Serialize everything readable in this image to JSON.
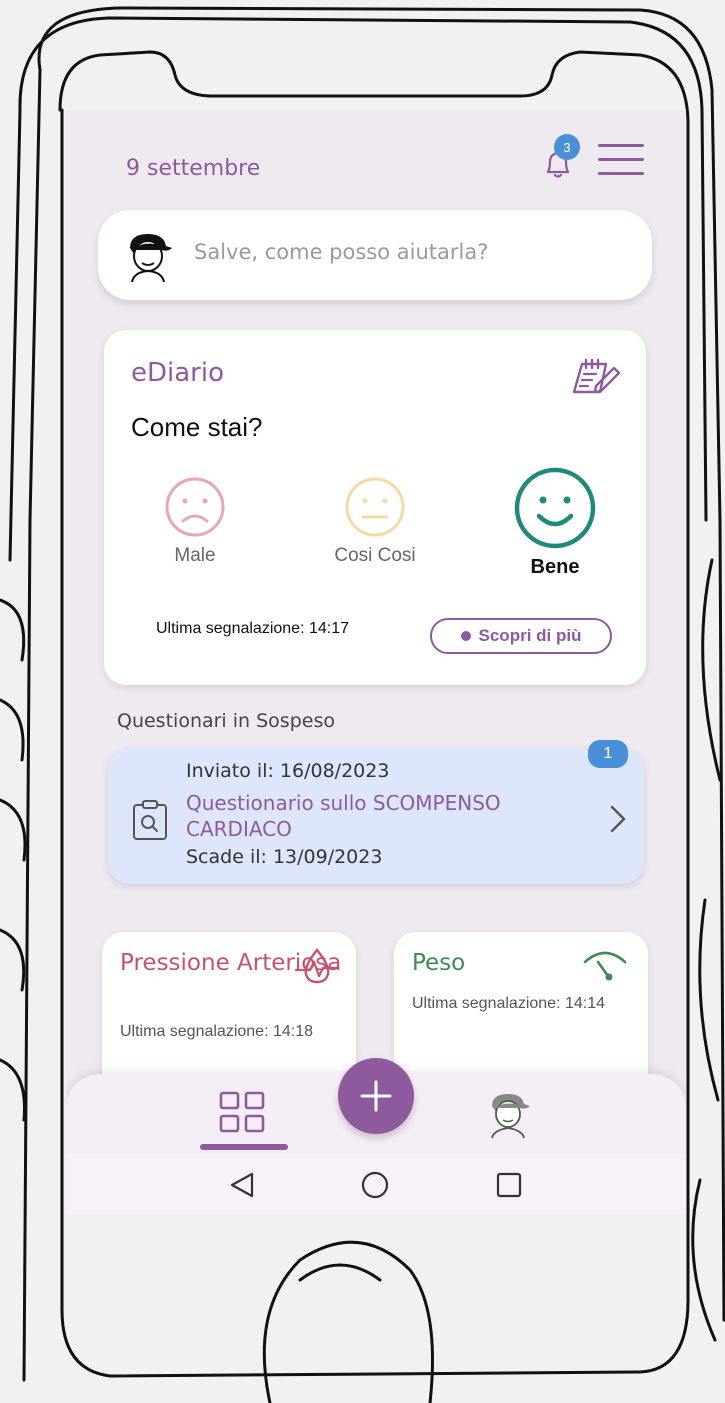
{
  "header": {
    "date": "9 settembre",
    "notification_count": "3"
  },
  "assistant": {
    "placeholder": "Salve, come posso aiutarla?"
  },
  "ediario": {
    "title": "eDiario",
    "question": "Come stai?",
    "moods": [
      {
        "label": "Male",
        "color": "#e8a6b8"
      },
      {
        "label": "Cosi Cosi",
        "color": "#f5d9a6"
      },
      {
        "label": "Bene",
        "color": "#1f8a7c",
        "selected": true
      }
    ],
    "last_report": "Ultima segnalazione: 14:17",
    "more_label": "Scopri di più"
  },
  "pending": {
    "section_title": "Questionari in Sospeso",
    "badge": "1",
    "sent": "Inviato il: 16/08/2023",
    "name": "Questionario sullo SCOMPENSO CARDIACO",
    "expires": "Scade il: 13/09/2023"
  },
  "metrics": [
    {
      "title": "Pressione Arteriosa",
      "last_report": "Ultima segnalazione: 14:18",
      "icon": "blood-drop-icon",
      "color": "#c8526a"
    },
    {
      "title": "Peso",
      "last_report": "Ultima segnalazione: 14:14",
      "icon": "scale-gauge-icon",
      "color": "#3f8a53"
    }
  ],
  "colors": {
    "accent": "#8d5a9e",
    "badge": "#4a90d9",
    "questionnaire_bg": "#dde6fa"
  }
}
